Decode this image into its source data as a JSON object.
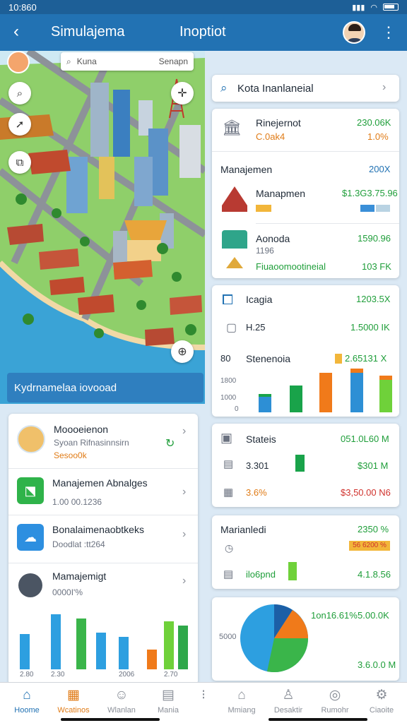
{
  "status": {
    "time": "10:860",
    "icons": "⌖ ✈"
  },
  "header": {
    "title": "Simulajema",
    "title2": "Inoptiot"
  },
  "map": {
    "search_label": "Kuna",
    "search_hint": "Senapn",
    "banner": "Kydrnamelaa iovooad"
  },
  "search": {
    "value": "Kota Inanlaneial"
  },
  "finance": {
    "row1": {
      "title": "Rinejernot",
      "sub": "C.0ak4",
      "val": "230.06K",
      "pct": "1.0%"
    },
    "section": {
      "label": "Manajemen",
      "val": "200X"
    },
    "row2": {
      "title": "Manapmen",
      "val": "$1.3G3.75.96"
    },
    "row3": {
      "title": "Aonoda",
      "sub": "1196",
      "note": "Fiuaoomootineial",
      "val": "1590.96",
      "val2": "103 FK"
    }
  },
  "stats1": {
    "row1": {
      "title": "Icagia",
      "val": "1203.5X"
    },
    "row2": {
      "title": "H.25",
      "val": "1.5000 IK"
    },
    "row3": {
      "title": "Stenenoia",
      "prefix": "80",
      "val": "2.65131 X"
    },
    "y_ticks": [
      "1800",
      "1000",
      "0"
    ]
  },
  "stats2": {
    "row1": {
      "title": "Stateis",
      "val": "051.0L60 M"
    },
    "row2": {
      "title": "3.301",
      "val": "$301 M"
    },
    "row3": {
      "title": "3.6%",
      "val": "$3,50.00 N6"
    }
  },
  "manage": {
    "title": "Marianledi",
    "val": "2350 %",
    "badge": "56 6200 %",
    "row2": {
      "title": "ilo6pnd",
      "val": "4.1.8.56"
    }
  },
  "pie": {
    "label1": "1on16.61%",
    "val1": "5.00.0K",
    "side": "5000",
    "val2": "3.6.0.0 M"
  },
  "list": {
    "item1": {
      "title": "Moooeienon",
      "sub": "Syoan Rifnasinnsirn",
      "meta": "Sesoo0k"
    },
    "item2": {
      "title": "Manajemen Abnalges",
      "meta": "1.00 00.1236"
    },
    "item3": {
      "title": "Bonalaimenaobtkeks",
      "sub": "Doodlat :tt264"
    },
    "item4": {
      "title": "Mamajemigt",
      "sub": "0000I'%"
    },
    "chart_xlabels": [
      "2.80",
      "2.30",
      "2006",
      "2.70"
    ]
  },
  "nav": [
    {
      "label": "Hoome",
      "icon": "⌂"
    },
    {
      "label": "Wcatinos",
      "icon": "▦"
    },
    {
      "label": "Wlanlan",
      "icon": "☺"
    },
    {
      "label": "Mania",
      "icon": "▤"
    },
    {
      "label": "",
      "icon": "⁝"
    },
    {
      "label": "Mmiang",
      "icon": "⌂"
    },
    {
      "label": "Desaktir",
      "icon": "♙"
    },
    {
      "label": "Rumohr",
      "icon": "◎"
    },
    {
      "label": "Ciaoite",
      "icon": "⚙"
    }
  ],
  "colors": {
    "primary": "#2272b3",
    "green": "#1f9e3a",
    "orange": "#e07b16",
    "red": "#d0322d"
  }
}
